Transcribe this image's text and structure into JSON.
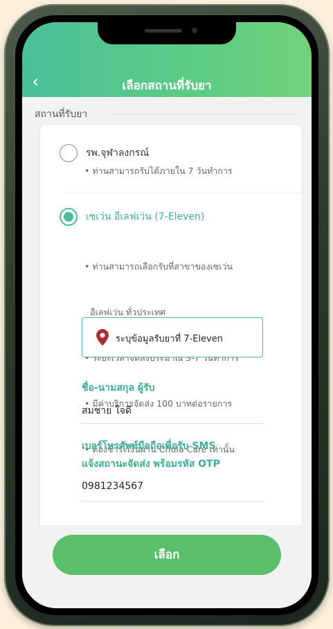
{
  "header": {
    "title": "เลือกสถานที่รับยา",
    "back_icon": "‹"
  },
  "section": {
    "label": "สถานที่รับยา"
  },
  "options": [
    {
      "title": "รพ.จุฬาลงกรณ์",
      "selected": false,
      "bullets": [
        "• ท่านสามารถรับได้ภายใน 7 วันทำการ"
      ]
    },
    {
      "title": "เซเว่น อีเลฟเว่น (7-Eleven)",
      "selected": true,
      "bullets": [
        "• ท่านสามารถเลือกรับที่สาขาของเซเว่น",
        "  อีเลฟเว่น ทั่วประเทศ",
        "• ระยะเวลาจัดส่งประมาณ 3-7 วันทำการ",
        "• มีค่าบริการจัดส่ง 100 บาทต่อรายการ",
        "• ต้องชำระเงินผ่าน Chula Care เท่านั้น"
      ]
    }
  ],
  "location_button": {
    "label": "ระบุข้อมูลรับยาที่ 7-Eleven",
    "icon": "map-pin-icon"
  },
  "fields": {
    "name_label": "ชื่อ-นามสกุล ผู้รับ",
    "name_value": "สมชาย ใจดี",
    "phone_label_line1": "เบอร์โทรศัพท์มือถือเพื่อรับ SMS",
    "phone_label_line2": "แจ้งสถานะจัดส่ง พร้อมรหัส OTP",
    "phone_value": "0981234567"
  },
  "footer": {
    "select_label": "เลือก"
  },
  "colors": {
    "accent": "#4bbf9a",
    "button": "#5cbf6b",
    "pin": "#b02a37"
  }
}
